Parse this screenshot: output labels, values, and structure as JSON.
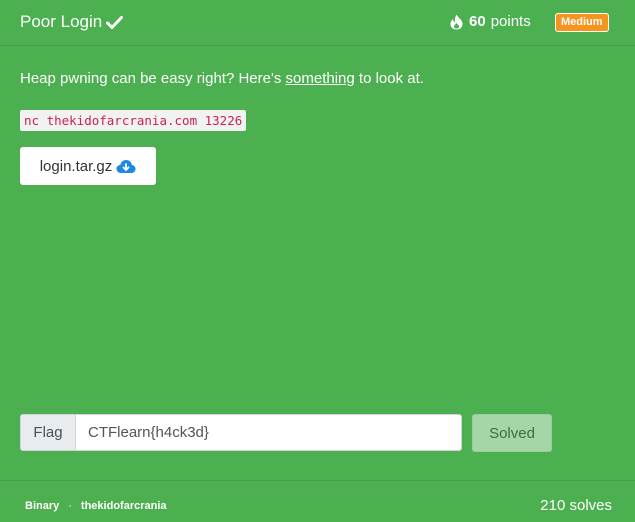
{
  "challenge": {
    "title": "Poor Login",
    "points_value": "60",
    "points_label": "points",
    "difficulty": "Medium",
    "description_before": "Heap pwning can be easy right? Here's ",
    "description_link": "something",
    "description_after": " to look at.",
    "connection": "nc thekidofarcrania.com 13226",
    "file_name": "login.tar.gz"
  },
  "flag_form": {
    "label": "Flag",
    "value": "CTFlearn{h4ck3d}",
    "button": "Solved"
  },
  "footer": {
    "category": "Binary",
    "separator": "·",
    "author": "thekidofarcrania",
    "solves": "210 solves"
  },
  "colors": {
    "card_bg": "#4caf50",
    "badge_bg": "#f7941d",
    "code_text": "#c7254e",
    "download_icon": "#1e88e5"
  },
  "icons": [
    "check-icon",
    "fire-icon",
    "cloud-download-icon"
  ]
}
